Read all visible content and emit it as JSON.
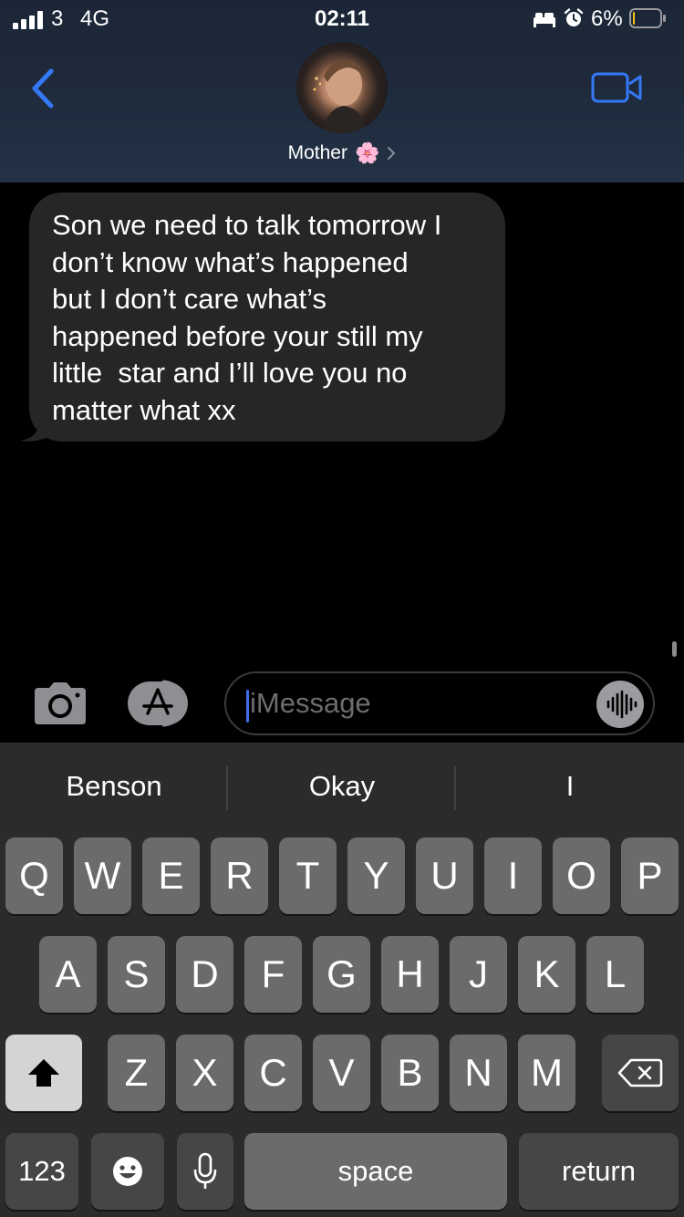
{
  "status_bar": {
    "carrier": "3",
    "network": "4G",
    "time": "02:11",
    "battery_percent": "6%",
    "battery_level": 0.06,
    "icons": [
      "signal-icon",
      "bed-icon",
      "alarm-icon",
      "battery-icon"
    ]
  },
  "header": {
    "back_icon": "chevron-left-icon",
    "contact_name": "Mother",
    "contact_emoji": "🌸",
    "video_icon": "video-camera-icon",
    "accent_color": "#3478f6"
  },
  "thread": {
    "messages": [
      {
        "direction": "incoming",
        "text": "Son we need to talk tomorrow I\ndon’t know what’s happened\nbut I don’t care what’s\nhappened before your still my\nlittle  star and I’ll love you no\nmatter what xx"
      }
    ]
  },
  "input_bar": {
    "camera_icon": "camera-icon",
    "apps_icon": "app-store-icon",
    "placeholder": "iMessage",
    "audio_icon": "audio-waveform-icon"
  },
  "keyboard": {
    "suggestions": [
      "Benson",
      "Okay",
      "I"
    ],
    "row1": [
      "Q",
      "W",
      "E",
      "R",
      "T",
      "Y",
      "U",
      "I",
      "O",
      "P"
    ],
    "row2": [
      "A",
      "S",
      "D",
      "F",
      "G",
      "H",
      "J",
      "K",
      "L"
    ],
    "row3": [
      "Z",
      "X",
      "C",
      "V",
      "B",
      "N",
      "M"
    ],
    "numbers_key": "123",
    "space_key": "space",
    "return_key": "return",
    "shift_icon": "shift-icon",
    "backspace_icon": "backspace-icon",
    "emoji_icon": "emoji-icon",
    "mic_icon": "microphone-icon"
  }
}
